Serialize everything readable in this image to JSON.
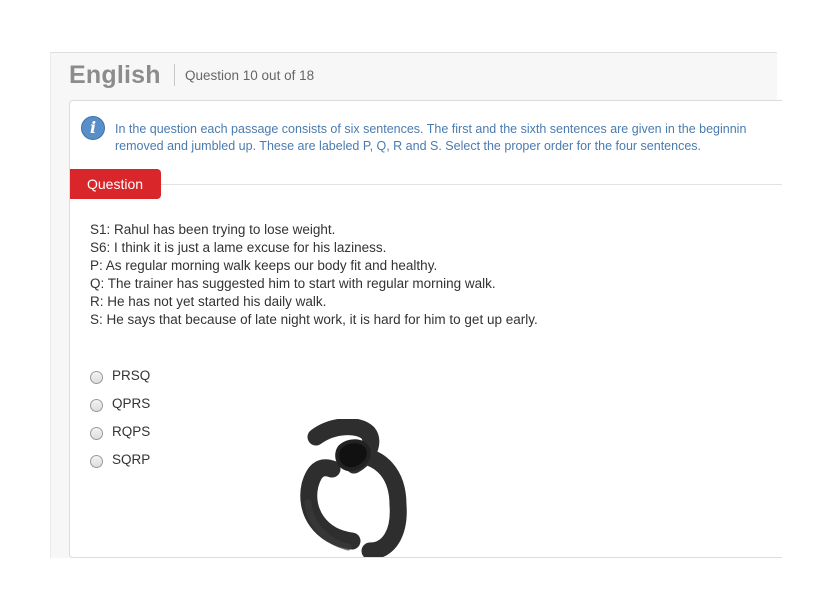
{
  "header": {
    "subject": "English",
    "question_counter": "Question 10 out of 18"
  },
  "instructions": {
    "icon": "info-icon",
    "line1": "In the question each passage consists of six sentences. The first and the sixth sentences are given in the beginnin",
    "line2": "removed and jumbled up. These are labeled P, Q, R and S. Select the proper order for the four sentences."
  },
  "question_tab": {
    "label": "Question"
  },
  "passage": [
    "S1: Rahul has been trying to lose weight.",
    "S6: I think it is just a lame excuse for his laziness.",
    "P: As regular morning walk keeps our body fit and healthy.",
    "Q: The trainer has suggested him to start with regular morning walk.",
    "R: He has not yet started his daily walk.",
    "S: He says that because of late night work, it is hard for him to get up early."
  ],
  "options": [
    {
      "label": "PRSQ",
      "selected": false
    },
    {
      "label": "QPRS",
      "selected": false
    },
    {
      "label": "RQPS",
      "selected": false
    },
    {
      "label": "SQRP",
      "selected": false
    }
  ],
  "colors": {
    "accent_red": "#d9262a",
    "info_blue": "#4a7bb0",
    "subject_gray": "#8c8c8c"
  }
}
